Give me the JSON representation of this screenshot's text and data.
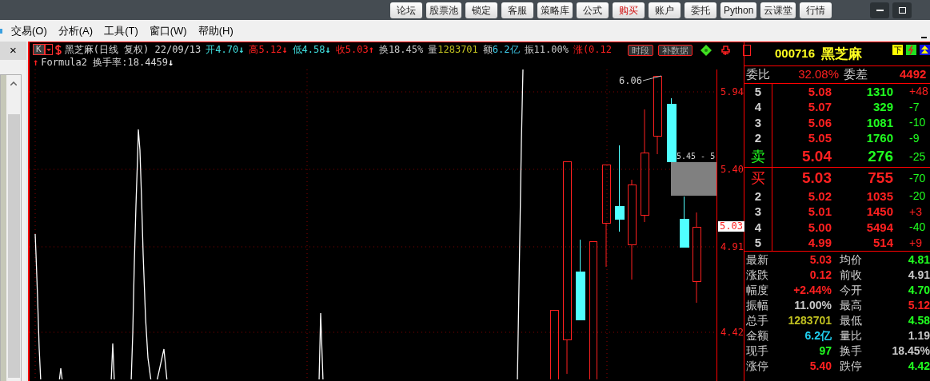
{
  "toolbar": {
    "buttons": [
      {
        "label": "论坛",
        "kind": "normal"
      },
      {
        "label": "股票池",
        "kind": "normal"
      },
      {
        "label": "锁定",
        "kind": "normal"
      },
      {
        "label": "客服",
        "kind": "normal"
      },
      {
        "label": "策略库",
        "kind": "normal"
      },
      {
        "label": "公式",
        "kind": "normal"
      },
      {
        "label": "购买",
        "kind": "highlight"
      },
      {
        "label": "账户",
        "kind": "normal"
      },
      {
        "label": "委托",
        "kind": "normal"
      },
      {
        "label": "Python",
        "kind": "normal"
      },
      {
        "label": "云课堂",
        "kind": "normal"
      },
      {
        "label": "行情",
        "kind": "normal"
      }
    ]
  },
  "menu": [
    "交易(O)",
    "分析(A)",
    "工具(T)",
    "窗口(W)",
    "帮助(H)"
  ],
  "left_panel": {
    "close": "×"
  },
  "chart": {
    "period_button": "K",
    "title": "黑芝麻(日线 复权) 22/09/13",
    "quotes": [
      {
        "label": "开",
        "value": "4.70",
        "color": "#40e0e0",
        "arrow": "↓"
      },
      {
        "label": "高",
        "value": "5.12",
        "color": "#ff2020",
        "arrow": "↓"
      },
      {
        "label": "低",
        "value": "4.58",
        "color": "#40e0e0",
        "arrow": "↓"
      },
      {
        "label": "收",
        "value": "5.03",
        "color": "#ff2020",
        "arrow": "↑"
      },
      {
        "label": "换",
        "value": "18.45%",
        "color": "#c8c8c8"
      },
      {
        "label": "量",
        "value": "1283701",
        "color": "#c0c020"
      },
      {
        "label": "额",
        "value": "6.2亿",
        "color": "#40d0f0"
      },
      {
        "label": "振",
        "value": "11.00%",
        "color": "#c8c8c8"
      },
      {
        "label": "涨",
        "value": "(0.12",
        "color": "#ff2020"
      }
    ],
    "tool_buttons": [
      "时段",
      "补数据"
    ],
    "indicator": {
      "up": "↑",
      "text": "Formula2 换手率:18.4459",
      "down": "↓"
    },
    "price_axis": [
      "5.94",
      "5.40",
      "4.91",
      "4.42"
    ],
    "current_price": "5.03",
    "high_label": "6.06",
    "range_label": "5.45 - 5"
  },
  "quote_panel": {
    "code": "000716",
    "name": "黑芝麻",
    "icon_label": "下",
    "ratio": {
      "label": "委比",
      "value": "32.08%",
      "diff_label": "委差",
      "diff_value": "4492"
    },
    "sell": [
      {
        "level": "5",
        "price": "5.08",
        "volume": "1310",
        "change": "+48",
        "color": "#ff2020",
        "kind": "level"
      },
      {
        "level": "4",
        "price": "5.07",
        "volume": "329",
        "change": "-7",
        "color": "#20ff20",
        "kind": "level"
      },
      {
        "level": "3",
        "price": "5.06",
        "volume": "1081",
        "change": "-10",
        "color": "#20ff20",
        "kind": "level"
      },
      {
        "level": "2",
        "price": "5.05",
        "volume": "1760",
        "change": "-9",
        "color": "#20ff20",
        "kind": "level"
      },
      {
        "level": "卖",
        "price": "5.04",
        "volume": "276",
        "change": "-25",
        "color": "#20ff20",
        "kind": "best"
      }
    ],
    "buy": [
      {
        "level": "买",
        "price": "5.03",
        "volume": "755",
        "change": "-70",
        "color": "#20ff20",
        "kind": "best"
      },
      {
        "level": "2",
        "price": "5.02",
        "volume": "1035",
        "change": "-20",
        "color": "#20ff20",
        "kind": "level"
      },
      {
        "level": "3",
        "price": "5.01",
        "volume": "1450",
        "change": "+3",
        "color": "#ff2020",
        "kind": "level"
      },
      {
        "level": "4",
        "price": "5.00",
        "volume": "5494",
        "change": "-40",
        "color": "#20ff20",
        "kind": "level"
      },
      {
        "level": "5",
        "price": "4.99",
        "volume": "514",
        "change": "+9",
        "color": "#ff2020",
        "kind": "level"
      }
    ],
    "stats": [
      [
        {
          "label": "最新",
          "value": "5.03",
          "color": "#ff2020"
        },
        {
          "label": "均价",
          "value": "4.81",
          "color": "#20ff20"
        }
      ],
      [
        {
          "label": "涨跌",
          "value": "0.12",
          "color": "#ff2020"
        },
        {
          "label": "前收",
          "value": "4.91",
          "color": "#c8c8c8"
        }
      ],
      [
        {
          "label": "幅度",
          "value": "+2.44%",
          "color": "#ff2020"
        },
        {
          "label": "今开",
          "value": "4.70",
          "color": "#20ff20"
        }
      ],
      [
        {
          "label": "振幅",
          "value": "11.00%",
          "color": "#c8c8c8"
        },
        {
          "label": "最高",
          "value": "5.12",
          "color": "#ff2020"
        }
      ],
      [
        {
          "label": "总手",
          "value": "1283701",
          "color": "#c0c020"
        },
        {
          "label": "最低",
          "value": "4.58",
          "color": "#20ff20"
        }
      ],
      [
        {
          "label": "金额",
          "value": "6.2亿",
          "color": "#20d0f0"
        },
        {
          "label": "量比",
          "value": "1.19",
          "color": "#c8c8c8"
        }
      ],
      [
        {
          "label": "现手",
          "value": "97",
          "color": "#20ff20"
        },
        {
          "label": "换手",
          "value": "18.45%",
          "color": "#c8c8c8"
        }
      ],
      [
        {
          "label": "涨停",
          "value": "5.40",
          "color": "#ff2020"
        },
        {
          "label": "跌停",
          "value": "4.42",
          "color": "#20ff20"
        }
      ]
    ]
  }
}
